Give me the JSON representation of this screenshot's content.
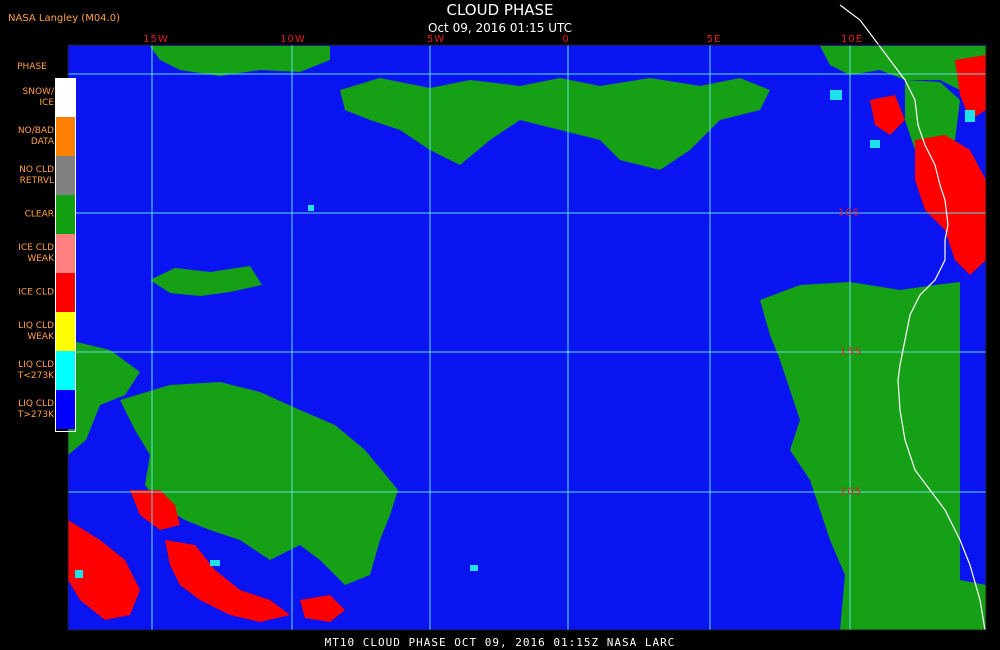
{
  "title": "CLOUD PHASE",
  "subtitle": "Oct 09, 2016 01:15 UTC",
  "producer": "NASA Langley (M04.0)",
  "legend_title": "PHASE",
  "legend": [
    {
      "label": "SNOW/\nICE",
      "color": "#ffffff"
    },
    {
      "label": "NO/BAD\nDATA",
      "color": "#ff8000"
    },
    {
      "label": "NO CLD\nRETRVL",
      "color": "#808080"
    },
    {
      "label": "CLEAR",
      "color": "#10a010"
    },
    {
      "label": "ICE CLD\nWEAK",
      "color": "#ff8080"
    },
    {
      "label": "ICE CLD",
      "color": "#ff0000"
    },
    {
      "label": "LIQ CLD\nWEAK",
      "color": "#ffff00"
    },
    {
      "label": "LIQ CLD\nT<273K",
      "color": "#00ffff"
    },
    {
      "label": "LIQ CLD\nT>273K",
      "color": "#0000ff"
    }
  ],
  "lon_labels": [
    "15W",
    "10W",
    "5W",
    "0",
    "5E",
    "10E"
  ],
  "lat_labels": [
    "10S",
    "15S",
    "20S"
  ],
  "footer": "MT10  CLOUD PHASE  OCT 09, 2016 01:15Z  NASA LARC",
  "colors": {
    "ocean_liquid": "#0a14f0",
    "clear": "#16a016",
    "ice": "#ff0000",
    "supercooled": "#20e0e8",
    "grid": "#60e0e0",
    "coast": "#ffffff",
    "label": "#e02020"
  }
}
